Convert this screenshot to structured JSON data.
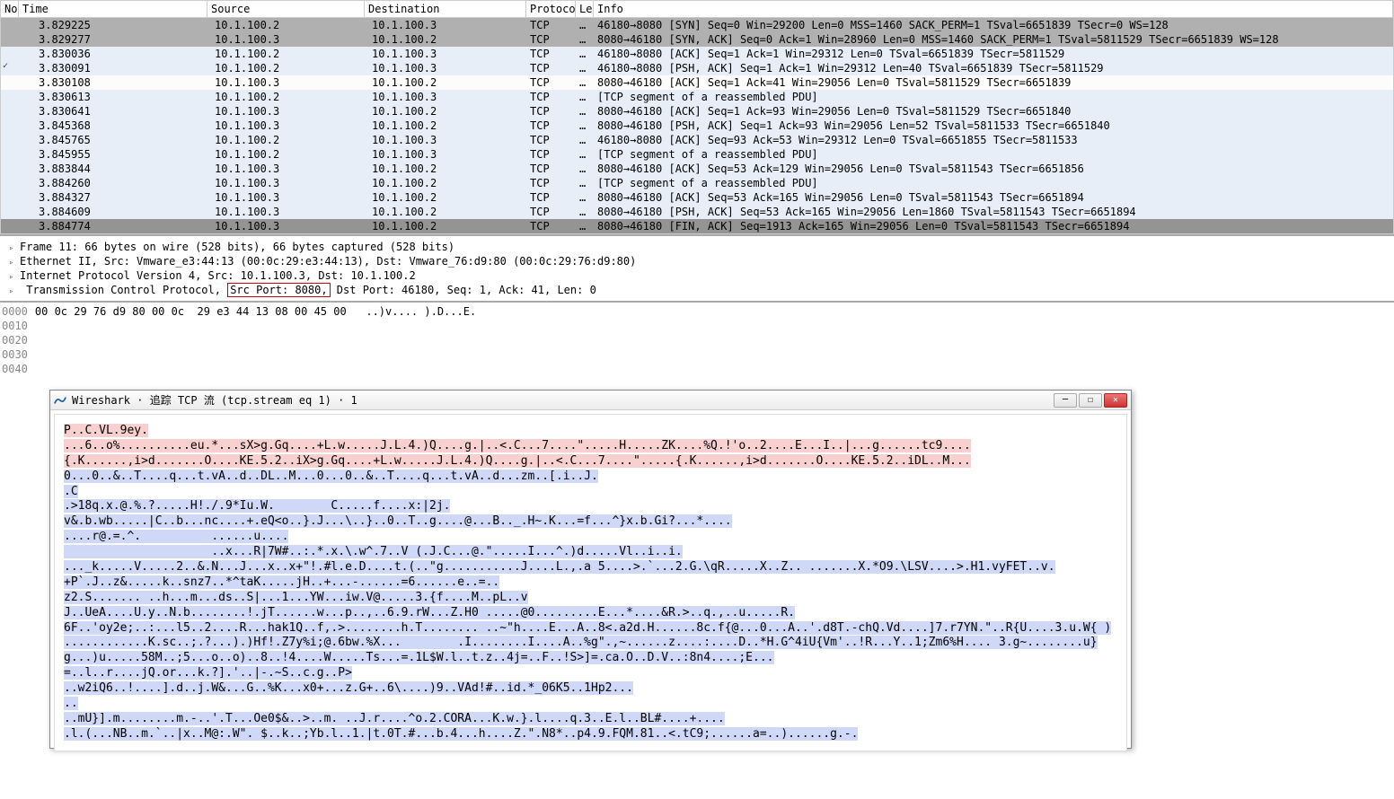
{
  "columns": {
    "no": "No",
    "time": "Time",
    "source": "Source",
    "destination": "Destination",
    "protocol": "Protocol",
    "length": "Le",
    "info": "Info"
  },
  "packets": [
    {
      "time": "3.829225",
      "src": "10.1.100.2",
      "dst": "10.1.100.3",
      "proto": "TCP",
      "len": "…",
      "info": "46180→8080 [SYN] Seq=0 Win=29200 Len=0 MSS=1460 SACK_PERM=1 TSval=6651839 TSecr=0 WS=128",
      "bg": "gray",
      "mark": ""
    },
    {
      "time": "3.829277",
      "src": "10.1.100.3",
      "dst": "10.1.100.2",
      "proto": "TCP",
      "len": "…",
      "info": "8080→46180 [SYN, ACK] Seq=0 Ack=1 Win=28960 Len=0 MSS=1460 SACK_PERM=1 TSval=5811529 TSecr=6651839 WS=128",
      "bg": "gray",
      "mark": ""
    },
    {
      "time": "3.830036",
      "src": "10.1.100.2",
      "dst": "10.1.100.3",
      "proto": "TCP",
      "len": "…",
      "info": "46180→8080 [ACK] Seq=1 Ack=1 Win=29312 Len=0 TSval=6651839 TSecr=5811529",
      "bg": "light",
      "mark": ""
    },
    {
      "time": "3.830091",
      "src": "10.1.100.2",
      "dst": "10.1.100.3",
      "proto": "TCP",
      "len": "…",
      "info": "46180→8080 [PSH, ACK] Seq=1 Ack=1 Win=29312 Len=40 TSval=6651839 TSecr=5811529",
      "bg": "light",
      "mark": "✓"
    },
    {
      "time": "3.830108",
      "src": "10.1.100.3",
      "dst": "10.1.100.2",
      "proto": "TCP",
      "len": "…",
      "info": "8080→46180 [ACK] Seq=1 Ack=41 Win=29056 Len=0 TSval=5811529 TSecr=6651839",
      "bg": "selected",
      "mark": ""
    },
    {
      "time": "3.830613",
      "src": "10.1.100.2",
      "dst": "10.1.100.3",
      "proto": "TCP",
      "len": "…",
      "info": "[TCP segment of a reassembled PDU]",
      "bg": "light",
      "mark": ""
    },
    {
      "time": "3.830641",
      "src": "10.1.100.3",
      "dst": "10.1.100.2",
      "proto": "TCP",
      "len": "…",
      "info": "8080→46180 [ACK] Seq=1 Ack=93 Win=29056 Len=0 TSval=5811529 TSecr=6651840",
      "bg": "light",
      "mark": ""
    },
    {
      "time": "3.845368",
      "src": "10.1.100.3",
      "dst": "10.1.100.2",
      "proto": "TCP",
      "len": "…",
      "info": "8080→46180 [PSH, ACK] Seq=1 Ack=93 Win=29056 Len=52 TSval=5811533 TSecr=6651840",
      "bg": "light",
      "mark": ""
    },
    {
      "time": "3.845765",
      "src": "10.1.100.2",
      "dst": "10.1.100.3",
      "proto": "TCP",
      "len": "…",
      "info": "46180→8080 [ACK] Seq=93 Ack=53 Win=29312 Len=0 TSval=6651855 TSecr=5811533",
      "bg": "light",
      "mark": ""
    },
    {
      "time": "3.845955",
      "src": "10.1.100.2",
      "dst": "10.1.100.3",
      "proto": "TCP",
      "len": "…",
      "info": "[TCP segment of a reassembled PDU]",
      "bg": "light",
      "mark": ""
    },
    {
      "time": "3.883844",
      "src": "10.1.100.3",
      "dst": "10.1.100.2",
      "proto": "TCP",
      "len": "…",
      "info": "8080→46180 [ACK] Seq=53 Ack=129 Win=29056 Len=0 TSval=5811543 TSecr=6651856",
      "bg": "light",
      "mark": ""
    },
    {
      "time": "3.884260",
      "src": "10.1.100.3",
      "dst": "10.1.100.2",
      "proto": "TCP",
      "len": "…",
      "info": "[TCP segment of a reassembled PDU]",
      "bg": "light",
      "mark": ""
    },
    {
      "time": "3.884327",
      "src": "10.1.100.3",
      "dst": "10.1.100.2",
      "proto": "TCP",
      "len": "…",
      "info": "8080→46180 [ACK] Seq=53 Ack=165 Win=29056 Len=0 TSval=5811543 TSecr=6651894",
      "bg": "light",
      "mark": ""
    },
    {
      "time": "3.884609",
      "src": "10.1.100.3",
      "dst": "10.1.100.2",
      "proto": "TCP",
      "len": "…",
      "info": "8080→46180 [PSH, ACK] Seq=53 Ack=165 Win=29056 Len=1860 TSval=5811543 TSecr=6651894",
      "bg": "light",
      "mark": ""
    },
    {
      "time": "3.884774",
      "src": "10.1.100.3",
      "dst": "10.1.100.2",
      "proto": "TCP",
      "len": "…",
      "info": "8080→46180 [FIN, ACK] Seq=1913 Ack=165 Win=29056 Len=0 TSval=5811543 TSecr=6651894",
      "bg": "dark",
      "mark": ""
    }
  ],
  "details": {
    "frame": "Frame 11: 66 bytes on wire (528 bits), 66 bytes captured (528 bits)",
    "ethernet": "Ethernet II, Src: Vmware_e3:44:13 (00:0c:29:e3:44:13), Dst: Vmware_76:d9:80 (00:0c:29:76:d9:80)",
    "ip": "Internet Protocol Version 4, Src: 10.1.100.3, Dst: 10.1.100.2",
    "tcp_pre": "Transmission Control Protocol, ",
    "tcp_src": "Src Port: 8080,",
    "tcp_post": " Dst Port: 46180, Seq: 1, Ack: 41, Len: 0"
  },
  "hex": {
    "offsets": [
      "0000",
      "0010",
      "0020",
      "0030",
      "0040"
    ],
    "line0_bytes": "00 0c 29 76 d9 80 00 0c  29 e3 44 13 08 00 45 00",
    "line0_ascii": "   ..)v.... ).D...E."
  },
  "dialog": {
    "title": "Wireshark · 追踪 TCP 流 (tcp.stream eq 1) · 1",
    "lines": [
      {
        "cls": "red",
        "t": "P..C.VL.9ey."
      },
      {
        "cls": "red",
        "t": "...6..o%..........eu.*...sX>g.Gq....+L.w.....J.L.4.)Q....g.|..<.C...7....\".....H.....ZK....%Q.!'o..2....E...I..|...g......tc9...."
      },
      {
        "cls": "red",
        "t": "{.K......,i>d.......O....KE.5.2..iX>g.Gq....+L.w.....J.L.4.)Q....g.|..<.C...7....\".....{.K......,i>d.......O....KE.5.2..iDL..M..."
      },
      {
        "cls": "blue",
        "t": "0...0..&..T....q...t.vA..d..DL..M...0...0..&..T....q...t.vA..d...zm..[.i..J."
      },
      {
        "cls": "blue",
        "t": ".C"
      },
      {
        "cls": "blue",
        "t": ".>18q.x.@.%.?.....H!./.9*Iu.W.        C.....f....x:|2j."
      },
      {
        "cls": "blue",
        "t": "v&.b.wb.....|C..b...nc....+.eQ<o..}.J...\\..}..0..T..g....@...B.._.H~.K...=f...^}x.b.Gi?...*...."
      },
      {
        "cls": "blue",
        "t": "....r@.=.^.          ......u...."
      },
      {
        "cls": "blue",
        "t": "                     ..x...R|7W#..:.*.x.\\.w^.7..V (.J.C...@.\".....I...^.)d.....Vl..i..i."
      },
      {
        "cls": "blue",
        "t": "..._k.....V.....2..&.N...J...x..x+\"!.#l.e.D....t.(..\"g...........J....L.,.a 5....>.`...2.G.\\qR.....X..Z.. .......X.*O9.\\LSV....>.H1.vyFET..v."
      },
      {
        "cls": "blue",
        "t": "+P`.J..z&.....k..snz7..*^taK.....jH..+...-......=6......e..=.."
      },
      {
        "cls": "blue",
        "t": "z2.S....... ..h...m...ds..S|...1...YW...iw.V@.....3.{f....M..pL..v"
      },
      {
        "cls": "blue",
        "t": "J..UeA....U.y..N.b........!.jT......w...p..,..6.9.rW...Z.H0 .....@0.........E...*....&R.>..q.,..u.....R."
      },
      {
        "cls": "blue",
        "t": "6F..'oy2e;..:...l5..2....R...hak1Q..f,.>........h.T........ ..~\"h....E...A..8<.a2d.H......8c.f{@...0...A..'.d8T.-chQ.Vd....]7.r7YN.\"..R{U....3.u.W{ )"
      },
      {
        "cls": "blue",
        "t": "............K.sc..;.?...).)Hf!.Z7y%i;@.6bw.%X...        .I........I....A..%g\".,~......z....:....D..*H.G^4iU{Vm'..!R...Y..1;Zm6%H.... 3.g~........u}"
      },
      {
        "cls": "blue",
        "t": "g...)u.....58M..;5...o..o)..8..!4....W.....Ts...=.1L$W.l..t.z..4j=..F..!S>]=.ca.O..D.V..:8n4....;E..."
      },
      {
        "cls": "blue",
        "t": "=..l..r....jQ.or...k.?].'..|-.~S..c.g..P>"
      },
      {
        "cls": "blue",
        "t": "..w2iQ6..!....].d..j.W&...G..%K...x0+...z.G+..6\\....)9..VAd!#..id.*_06K5..1Hp2..."
      },
      {
        "cls": "blue",
        "t": ".."
      },
      {
        "cls": "blue",
        "t": "..mU}].m........m.-..'.T...Oe0$&..>..m. ..J.r....^o.2.CORA...K.w.}.l....q.3..E.l..BL#....+...."
      },
      {
        "cls": "blue",
        "t": ".l.(...NB..m.`..|x..M@:.W\". $..k..;Yb.l..1.|t.0T.#...b.4...h....Z.\".N8*..p4.9.FQM.81..<.tC9;......a=..)......g.-."
      }
    ]
  }
}
